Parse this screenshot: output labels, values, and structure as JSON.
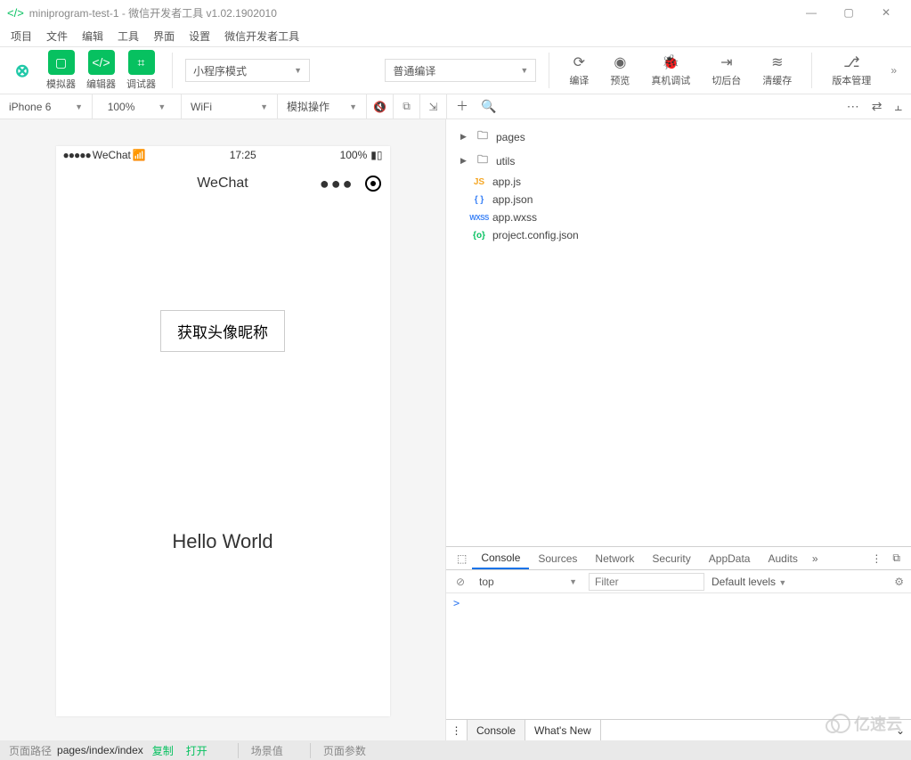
{
  "titlebar": {
    "title": "miniprogram-test-1 - 微信开发者工具 v1.02.1902010"
  },
  "menu": {
    "items": [
      "项目",
      "文件",
      "编辑",
      "工具",
      "界面",
      "设置",
      "微信开发者工具"
    ]
  },
  "toolbar": {
    "simulator": "模拟器",
    "editor": "编辑器",
    "debugger": "调试器",
    "mode": "小程序模式",
    "compileMode": "普通编译",
    "compile": "编译",
    "preview": "预览",
    "remote": "真机调试",
    "background": "切后台",
    "clearCache": "清缓存",
    "version": "版本管理"
  },
  "devicebar": {
    "device": "iPhone 6",
    "zoom": "100%",
    "network": "WiFi",
    "simop": "模拟操作"
  },
  "simulator": {
    "carrier": "WeChat",
    "time": "17:25",
    "battery": "100%",
    "navTitle": "WeChat",
    "getProfileBtn": "获取头像昵称",
    "hello": "Hello World"
  },
  "tree": {
    "items": [
      {
        "type": "folder",
        "name": "pages",
        "icon": "folder"
      },
      {
        "type": "folder",
        "name": "utils",
        "icon": "folder"
      },
      {
        "type": "file",
        "name": "app.js",
        "icon": "js",
        "badge": "JS"
      },
      {
        "type": "file",
        "name": "app.json",
        "icon": "json",
        "badge": "{ }"
      },
      {
        "type": "file",
        "name": "app.wxss",
        "icon": "wxss",
        "badge": "WXSS"
      },
      {
        "type": "file",
        "name": "project.config.json",
        "icon": "cfg",
        "badge": "{o}"
      }
    ]
  },
  "devtools": {
    "tabs": [
      "Console",
      "Sources",
      "Network",
      "Security",
      "AppData",
      "Audits"
    ],
    "context": "top",
    "filterPlaceholder": "Filter",
    "levels": "Default levels",
    "bottomTabs": [
      "Console",
      "What's New"
    ]
  },
  "statusline": {
    "pathLabel": "页面路径",
    "pathValue": "pages/index/index",
    "copy": "复制",
    "open": "打开",
    "scene": "场景值",
    "params": "页面参数"
  },
  "watermark": "亿速云"
}
